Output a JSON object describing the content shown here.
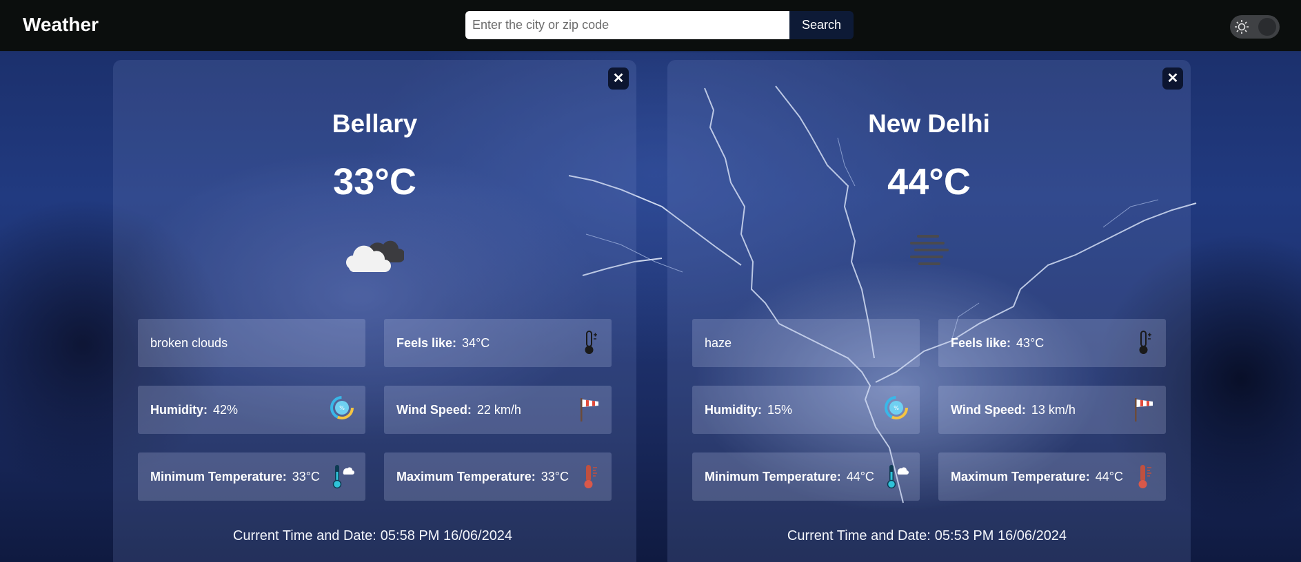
{
  "app": {
    "title": "Weather"
  },
  "search": {
    "placeholder": "Enter the city or zip code",
    "value": "",
    "button_label": "Search"
  },
  "theme_toggle": {
    "state": "dark",
    "icon": "sun-icon"
  },
  "cards": [
    {
      "city": "Bellary",
      "temperature": "33°C",
      "condition_icon": "broken-clouds-icon",
      "description": "broken clouds",
      "feels_like": {
        "label": "Feels like:",
        "value": "34°C"
      },
      "humidity": {
        "label": "Humidity:",
        "value": "42%"
      },
      "wind_speed": {
        "label": "Wind Speed:",
        "value": "22 km/h"
      },
      "min_temp": {
        "label": "Minimum Temperature:",
        "value": "33°C"
      },
      "max_temp": {
        "label": "Maximum Temperature:",
        "value": "33°C"
      },
      "datetime_label": "Current Time and Date:",
      "datetime_value": "05:58 PM 16/06/2024"
    },
    {
      "city": "New Delhi",
      "temperature": "44°C",
      "condition_icon": "haze-icon",
      "description": "haze",
      "feels_like": {
        "label": "Feels like:",
        "value": "43°C"
      },
      "humidity": {
        "label": "Humidity:",
        "value": "15%"
      },
      "wind_speed": {
        "label": "Wind Speed:",
        "value": "13 km/h"
      },
      "min_temp": {
        "label": "Minimum Temperature:",
        "value": "44°C"
      },
      "max_temp": {
        "label": "Maximum Temperature:",
        "value": "44°C"
      },
      "datetime_label": "Current Time and Date:",
      "datetime_value": "05:53 PM 16/06/2024"
    }
  ],
  "colors": {
    "topbar": "#0b0e0d",
    "search_button": "#0d1a36",
    "close_button": "#0c1530"
  }
}
